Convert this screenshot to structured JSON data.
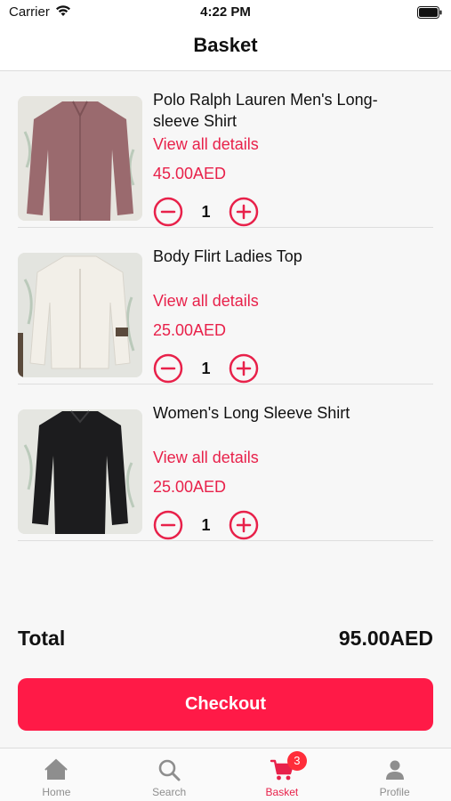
{
  "status_bar": {
    "carrier": "Carrier",
    "time": "4:22 PM"
  },
  "header": {
    "title": "Basket"
  },
  "basket": {
    "items": [
      {
        "name": "Polo Ralph Lauren Men's Long-sleeve Shirt",
        "details_link": "View all details",
        "price": "45.00AED",
        "quantity": "1",
        "shirt_color": "#9a6a6e"
      },
      {
        "name": "Body Flirt Ladies Top",
        "details_link": "View all details",
        "price": "25.00AED",
        "quantity": "1",
        "shirt_color": "#f2efe8"
      },
      {
        "name": "Women's Long Sleeve Shirt",
        "details_link": "View all details",
        "price": "25.00AED",
        "quantity": "1",
        "shirt_color": "#1c1c1e"
      }
    ]
  },
  "summary": {
    "total_label": "Total",
    "total_value": "95.00AED"
  },
  "checkout": {
    "label": "Checkout"
  },
  "tab_bar": {
    "tabs": [
      {
        "label": "Home",
        "icon": "home-icon"
      },
      {
        "label": "Search",
        "icon": "search-icon"
      },
      {
        "label": "Basket",
        "icon": "cart-icon",
        "badge": "3",
        "active": true
      },
      {
        "label": "Profile",
        "icon": "profile-icon"
      }
    ]
  },
  "colors": {
    "accent": "#e8214a",
    "checkout_bg": "#ff1a47",
    "badge": "#ff2d3a"
  }
}
